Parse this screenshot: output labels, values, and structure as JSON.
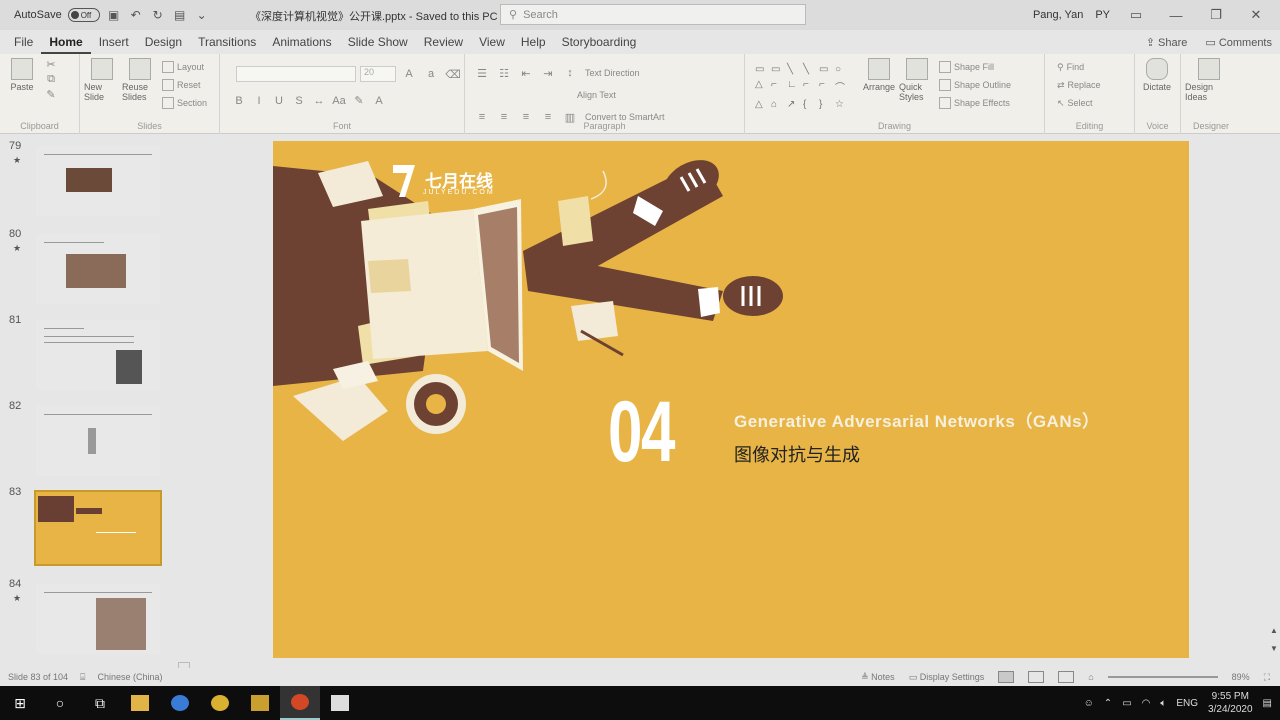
{
  "titlebar": {
    "autosave_label": "AutoSave",
    "autosave_state": "Off",
    "doc_title": "《深度计算机视觉》公开课.pptx",
    "saved_status": "Saved to this PC",
    "search_placeholder": "Search",
    "user_name": "Pang, Yan",
    "user_initials": "PY"
  },
  "menu": {
    "tabs": [
      "File",
      "Home",
      "Insert",
      "Design",
      "Transitions",
      "Animations",
      "Slide Show",
      "Review",
      "View",
      "Help",
      "Storyboarding"
    ],
    "active_tab": "Home",
    "share_label": "Share",
    "comments_label": "Comments"
  },
  "ribbon": {
    "clipboard": {
      "label": "Clipboard",
      "paste": "Paste"
    },
    "slides": {
      "label": "Slides",
      "new_slide": "New Slide",
      "reuse_slides": "Reuse Slides",
      "layout": "Layout",
      "reset": "Reset",
      "section": "Section"
    },
    "font": {
      "label": "Font",
      "font_size": "20"
    },
    "paragraph": {
      "label": "Paragraph",
      "text_direction": "Text Direction",
      "align_text": "Align Text",
      "smartart": "Convert to SmartArt"
    },
    "drawing": {
      "label": "Drawing",
      "arrange": "Arrange",
      "quick_styles": "Quick Styles",
      "shape_fill": "Shape Fill",
      "shape_outline": "Shape Outline",
      "shape_effects": "Shape Effects"
    },
    "editing": {
      "label": "Editing",
      "find": "Find",
      "replace": "Replace",
      "select": "Select"
    },
    "voice": {
      "label": "Voice",
      "dictate": "Dictate"
    },
    "designer": {
      "label": "Designer",
      "design_ideas": "Design Ideas"
    }
  },
  "thumbnails": [
    {
      "number": "79",
      "star": "★"
    },
    {
      "number": "80",
      "star": "★"
    },
    {
      "number": "81",
      "star": ""
    },
    {
      "number": "82",
      "star": ""
    },
    {
      "number": "83",
      "star": ""
    },
    {
      "number": "84",
      "star": "★"
    }
  ],
  "slide": {
    "logo_text": "七月在线",
    "logo_sub": "JULYEDU.COM",
    "number": "04",
    "heading": "Generative Adversarial Networks（GANs）",
    "subtitle": "图像对抗与生成"
  },
  "statusbar": {
    "slide_counter": "Slide 83 of 104",
    "language": "Chinese (China)",
    "notes": "Notes",
    "display_settings": "Display Settings",
    "zoom": "89%"
  },
  "taskbar": {
    "lang": "ENG",
    "time": "9:55 PM",
    "date": "3/24/2020"
  },
  "colors": {
    "slide_bg": "#e8b446",
    "skin": "#7b4a3a",
    "ribbon_bg": "#f0efe9"
  }
}
